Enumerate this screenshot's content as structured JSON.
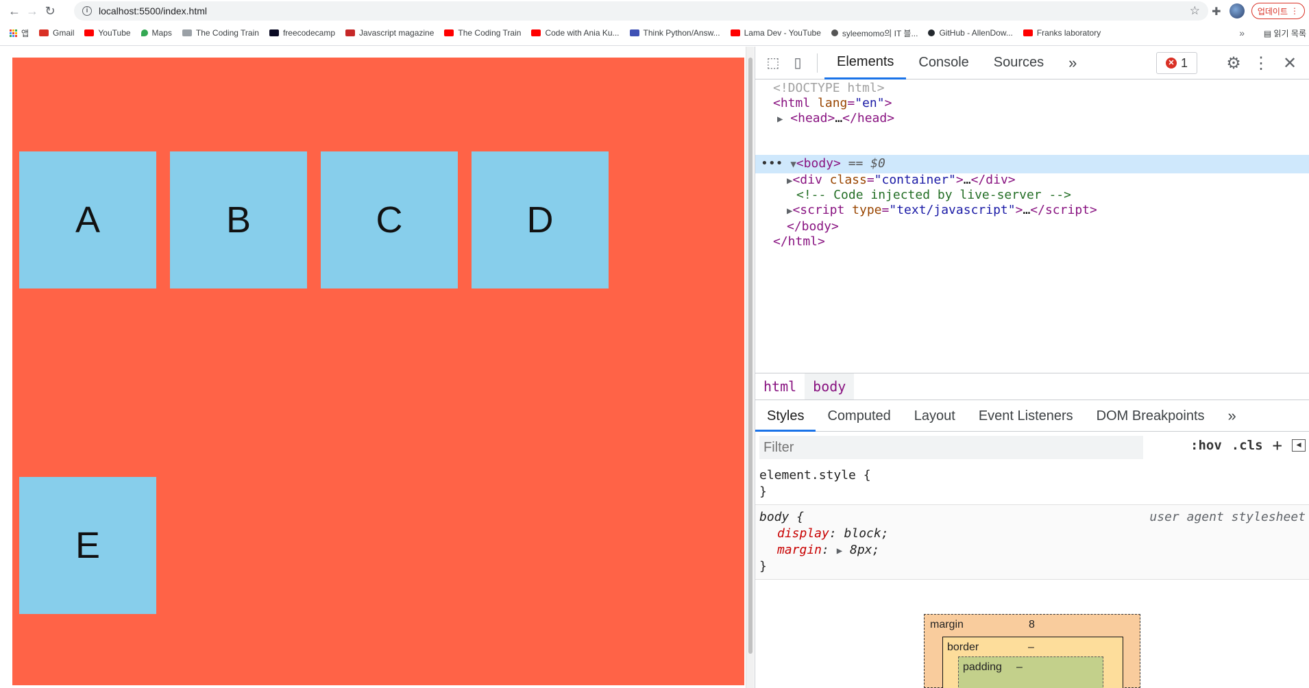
{
  "browser": {
    "url": "localhost:5500/index.html",
    "update_label": "업데이트",
    "apps_label": "앱",
    "bookmarks": [
      {
        "label": "Gmail",
        "color": "#d93025"
      },
      {
        "label": "YouTube",
        "color": "#ff0000"
      },
      {
        "label": "Maps",
        "color": "#34a853"
      },
      {
        "label": "The Coding Train",
        "color": "#9aa0a6"
      },
      {
        "label": "freecodecamp",
        "color": "#0a0a23"
      },
      {
        "label": "Javascript magazine",
        "color": "#c62828"
      },
      {
        "label": "The Coding Train",
        "color": "#ff0000"
      },
      {
        "label": "Code with Ania Ku...",
        "color": "#ff0000"
      },
      {
        "label": "Think Python/Answ...",
        "color": "#3f51b5"
      },
      {
        "label": "Lama Dev - YouTube",
        "color": "#ff0000"
      },
      {
        "label": "syleemomo의 IT 블...",
        "color": "#555555"
      },
      {
        "label": "GitHub - AllenDow...",
        "color": "#24292e"
      },
      {
        "label": "Franks laboratory",
        "color": "#ff0000"
      }
    ],
    "bookmarks_more": "»",
    "reading_list": "읽기 목록"
  },
  "page": {
    "container_color": "#ff6347",
    "box_color": "#87ceeb",
    "boxes": [
      "A",
      "B",
      "C",
      "D",
      "E"
    ]
  },
  "devtools": {
    "tabs": [
      "Elements",
      "Console",
      "Sources"
    ],
    "more_tabs": "»",
    "error_count": "1",
    "dom": {
      "doctype": "<!DOCTYPE html>",
      "html_open_tag": "html",
      "html_lang_attr": "lang",
      "html_lang_val": "\"en\"",
      "head": "head",
      "body": "body",
      "body_marker": "== $0",
      "div_tag": "div",
      "div_attr": "class",
      "div_val": "\"container\"",
      "comment": "<!-- Code injected by live-server -->",
      "script_tag": "script",
      "script_attr": "type",
      "script_val": "\"text/javascript\"",
      "ellipsis": "…",
      "body_close": "</body>",
      "html_close": "</html>"
    },
    "breadcrumbs": [
      "html",
      "body"
    ],
    "sub_tabs": [
      "Styles",
      "Computed",
      "Layout",
      "Event Listeners",
      "DOM Breakpoints"
    ],
    "filter_placeholder": "Filter",
    "hov": ":hov",
    "cls": ".cls",
    "rules": {
      "element_style": "element.style {",
      "close": "}",
      "body_selector": "body {",
      "ua_label": "user agent stylesheet",
      "display_prop": "display",
      "display_val": "block;",
      "margin_prop": "margin",
      "margin_val": "8px;"
    },
    "box_model": {
      "margin_label": "margin",
      "margin_val": "8",
      "border_label": "border",
      "border_val": "–",
      "padding_label": "padding",
      "padding_val": "–"
    }
  }
}
